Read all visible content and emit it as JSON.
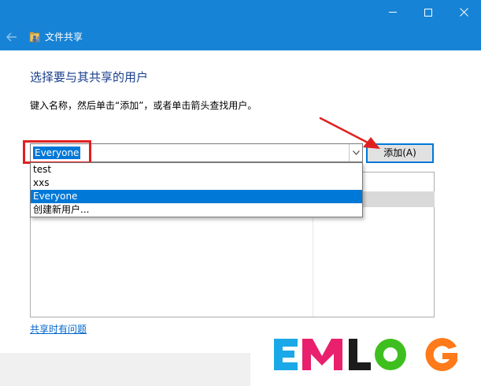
{
  "window": {
    "title": "文件共享"
  },
  "main": {
    "heading": "选择要与其共享的用户",
    "instruction": "键入名称，然后单击“添加”，或者单击箭头查找用户。",
    "combo_value": "Everyone",
    "add_button_label": "添加(A)",
    "dropdown_options": [
      "test",
      "xxs",
      "Everyone",
      "创建新用户..."
    ],
    "selected_option": "Everyone",
    "help_link": "共享时有问题"
  },
  "watermark": {
    "text": "EMLOG",
    "letter_colors": [
      "#1aa8e8",
      "#e8206e",
      "#1c1c1c",
      "#3fbf1f",
      "#ff7a1a"
    ]
  },
  "colors": {
    "title_bar": "#1783d6",
    "selection": "#0078d7",
    "heading": "#1a3e8c",
    "annotation_red": "#e02020"
  }
}
